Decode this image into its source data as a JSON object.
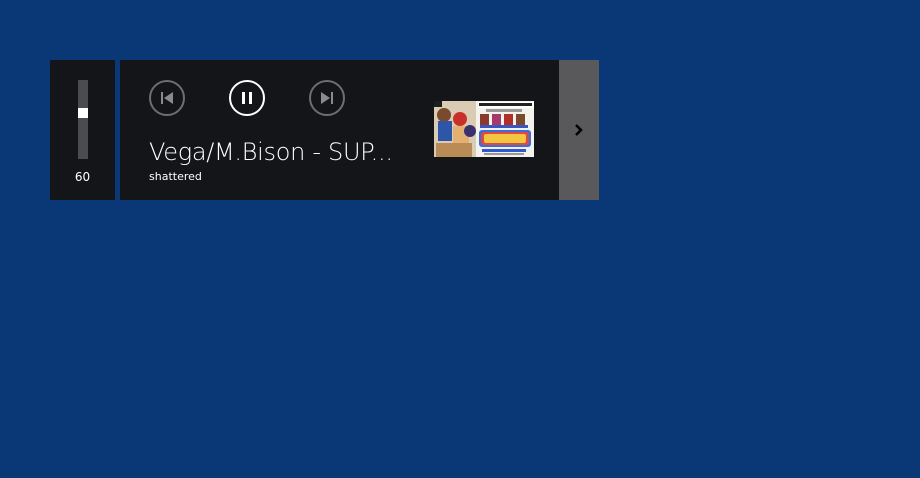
{
  "volume": {
    "value_label": "60",
    "level": 0.6
  },
  "player": {
    "controls": {
      "previous_icon": "skip-previous-icon",
      "pause_icon": "pause-icon",
      "next_icon": "skip-next-icon"
    },
    "track_title": "Vega/M.Bison - SUP...",
    "artist": "shattered",
    "album_art_icon": "album-art-image"
  },
  "expand": {
    "icon": "chevron-right-icon"
  },
  "colors": {
    "desktop_background": "#0a3775",
    "panel_background": "#141518",
    "expand_background": "#59595b",
    "button_ring": "#6d6e70",
    "active_ring": "#ffffff"
  }
}
